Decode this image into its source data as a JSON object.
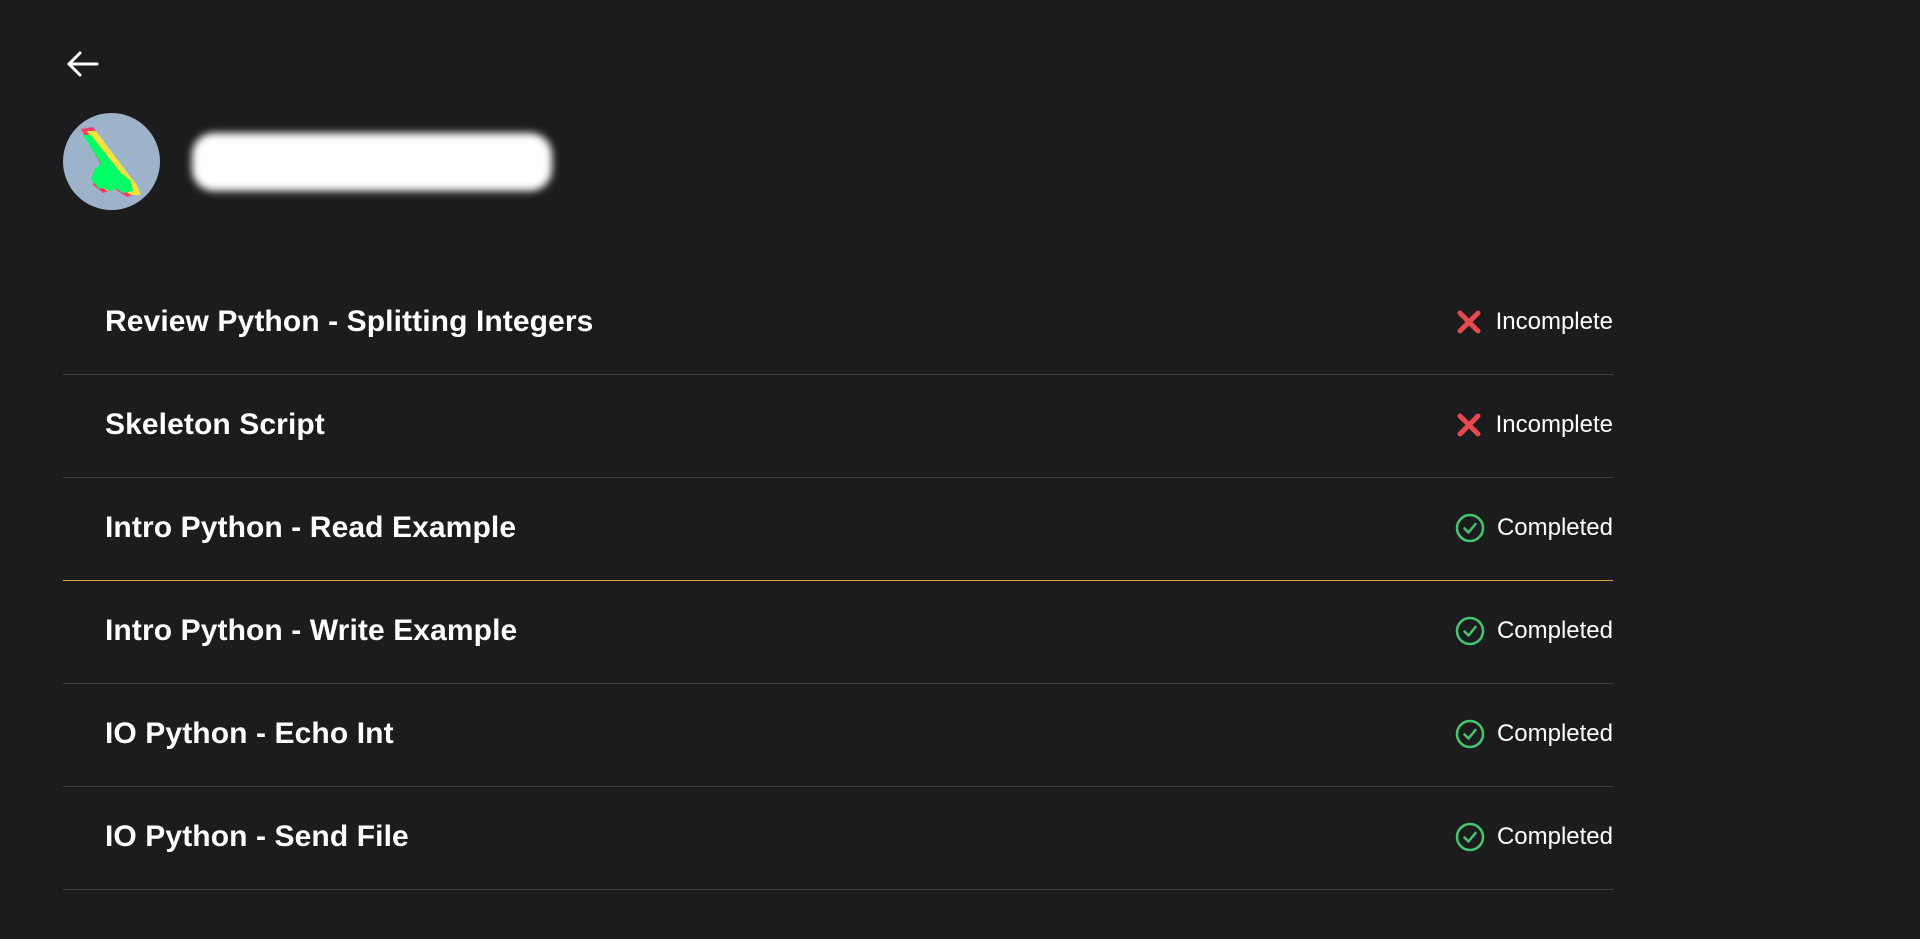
{
  "nav": {
    "back_icon": "arrow-left-icon"
  },
  "profile": {
    "avatar_icon": "pixel-hand-pointer-icon",
    "username": ""
  },
  "colors": {
    "background": "#1c1c1e",
    "incomplete": "#e5484d",
    "completed": "#46c46e",
    "selected_divider": "#d9a441",
    "divider": "#3d3d40"
  },
  "tasks": [
    {
      "title": "Review Python - Splitting Integers",
      "status": "Incomplete",
      "icon": "x-icon"
    },
    {
      "title": "Skeleton Script",
      "status": "Incomplete",
      "icon": "x-icon"
    },
    {
      "title": "Intro Python - Read Example",
      "status": "Completed",
      "icon": "check-circle-icon"
    },
    {
      "title": "Intro Python - Write Example",
      "status": "Completed",
      "icon": "check-circle-icon"
    },
    {
      "title": "IO Python - Echo Int",
      "status": "Completed",
      "icon": "check-circle-icon"
    },
    {
      "title": "IO Python - Send File",
      "status": "Completed",
      "icon": "check-circle-icon"
    }
  ]
}
